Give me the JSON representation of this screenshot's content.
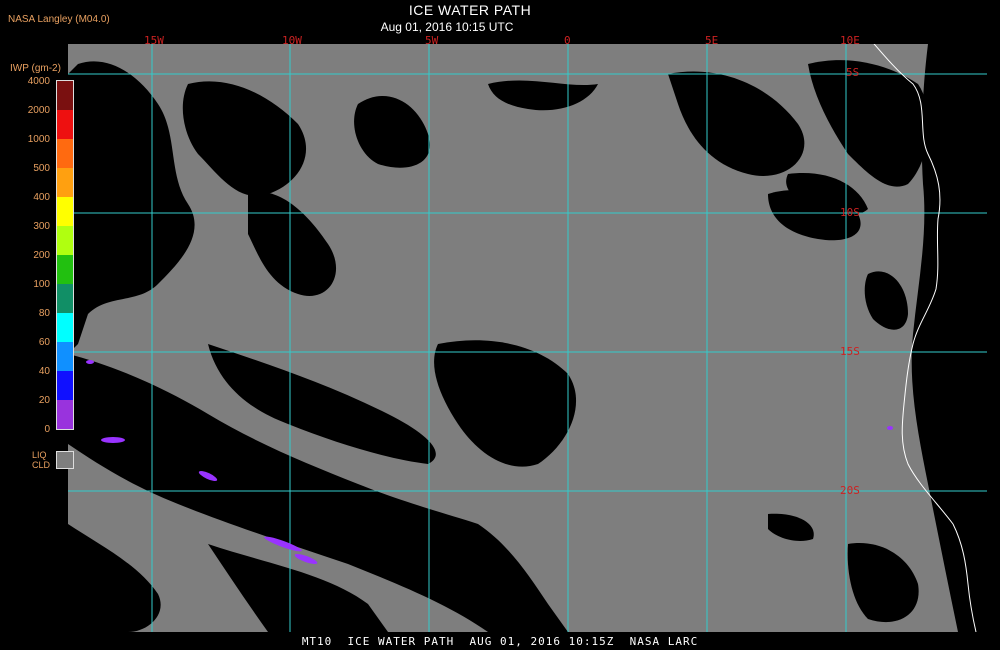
{
  "header": {
    "source": "NASA Langley (M04.0)",
    "title": "ICE WATER PATH",
    "subtitle": "Aug 01, 2016 10:15 UTC"
  },
  "legend": {
    "unit_label": "IWP (gm-2)",
    "ticks": [
      "4000",
      "2000",
      "1000",
      "500",
      "400",
      "300",
      "200",
      "100",
      "80",
      "60",
      "40",
      "20",
      "0"
    ],
    "colors": [
      "#7a1010",
      "#ee1010",
      "#ff6a10",
      "#ffa010",
      "#ffff00",
      "#b0ff10",
      "#22c010",
      "#118f66",
      "#00ffff",
      "#1090ff",
      "#1010ff",
      "#9933dd"
    ],
    "liq_label": "LIQ",
    "cld_label": "CLD",
    "liq_color": "#7e7e7e"
  },
  "grid": {
    "lon_labels": [
      "15W",
      "10W",
      "5W",
      "0",
      "5E",
      "10E"
    ],
    "lat_labels": [
      "5S",
      "10S",
      "15S",
      "20S"
    ],
    "line_color": "#33cccc"
  },
  "map": {
    "ocean_cloud_color": "#7e7e7e",
    "clear_color": "#000000",
    "coast_color": "#ffffff",
    "ice_color": "#9933ff"
  },
  "footer": {
    "text": "MT10  ICE WATER PATH  AUG 01, 2016 10:15Z  NASA LARC"
  }
}
